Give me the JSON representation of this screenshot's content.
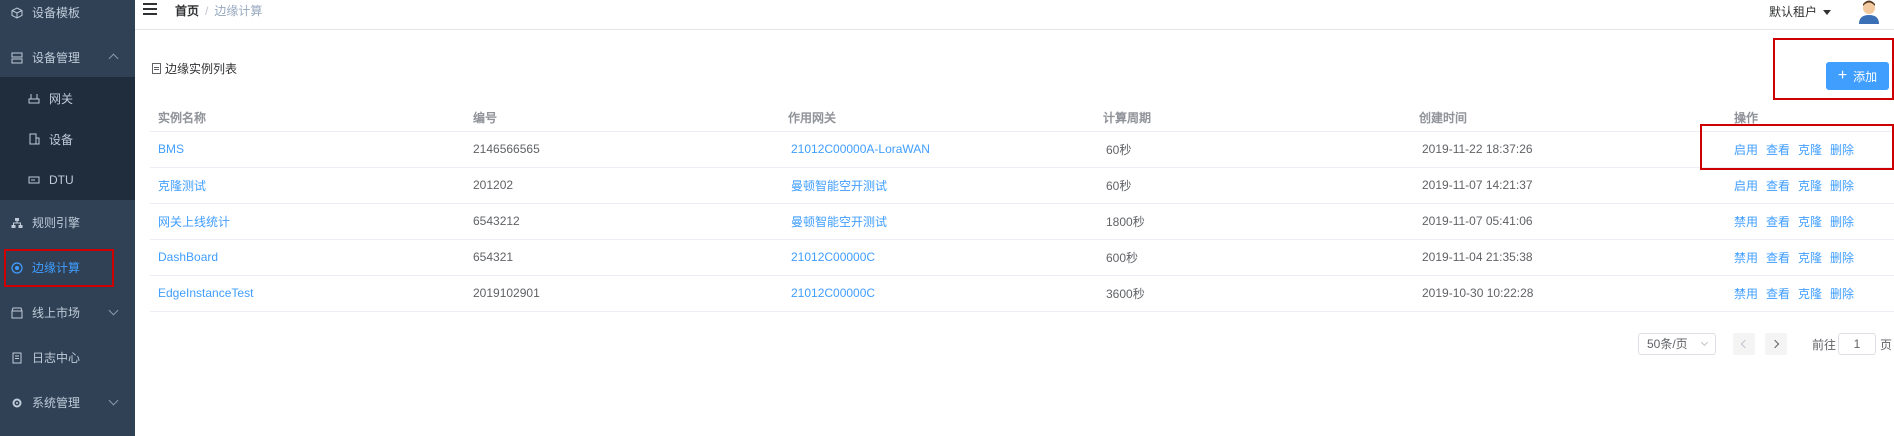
{
  "sidebar": {
    "items": [
      {
        "label": "设备模板",
        "icon": "cube-icon",
        "chevron": ""
      },
      {
        "label": "设备管理",
        "icon": "server-icon",
        "chevron": "up"
      },
      {
        "label": "网关",
        "icon": "gateway-icon",
        "chevron": ""
      },
      {
        "label": "设备",
        "icon": "device-icon",
        "chevron": ""
      },
      {
        "label": "DTU",
        "icon": "dtu-icon",
        "chevron": ""
      },
      {
        "label": "规则引擎",
        "icon": "sitemap-icon",
        "chevron": ""
      },
      {
        "label": "边缘计算",
        "icon": "edge-compute-icon",
        "chevron": "",
        "active": true
      },
      {
        "label": "线上市场",
        "icon": "market-icon",
        "chevron": "down"
      },
      {
        "label": "日志中心",
        "icon": "log-icon",
        "chevron": ""
      },
      {
        "label": "系统管理",
        "icon": "gear-icon",
        "chevron": "down"
      }
    ],
    "active_color": "#409eff"
  },
  "header": {
    "breadcrumb_home": "首页",
    "breadcrumb_sep": "/",
    "breadcrumb_current": "边缘计算",
    "tenant": "默认租户"
  },
  "main": {
    "panel_title": "边缘实例列表",
    "add_button": "添加",
    "columns": [
      "实例名称",
      "编号",
      "作用网关",
      "计算周期",
      "创建时间",
      "操作"
    ],
    "rows": [
      {
        "name": "BMS",
        "code": "2146566565",
        "gateway": "21012C00000A-LoraWAN",
        "period": "60秒",
        "created": "2019-11-22 18:37:26",
        "toggle": "启用"
      },
      {
        "name": "克隆测试",
        "code": "201202",
        "gateway": "曼顿智能空开测试",
        "period": "60秒",
        "created": "2019-11-07 14:21:37",
        "toggle": "启用"
      },
      {
        "name": "网关上线统计",
        "code": "6543212",
        "gateway": "曼顿智能空开测试",
        "period": "1800秒",
        "created": "2019-11-07 05:41:06",
        "toggle": "禁用"
      },
      {
        "name": "DashBoard",
        "code": "654321",
        "gateway": "21012C00000C",
        "period": "600秒",
        "created": "2019-11-04 21:35:38",
        "toggle": "禁用"
      },
      {
        "name": "EdgeInstanceTest",
        "code": "2019102901",
        "gateway": "21012C00000C",
        "period": "3600秒",
        "created": "2019-10-30 10:22:28",
        "toggle": "禁用"
      }
    ],
    "ops": {
      "view": "查看",
      "clone": "克隆",
      "delete": "删除"
    },
    "accent_color": "#409eff"
  },
  "pagination": {
    "page_size": "50条/页",
    "goto_label": "前往",
    "current_page": "1",
    "page_unit": "页"
  }
}
